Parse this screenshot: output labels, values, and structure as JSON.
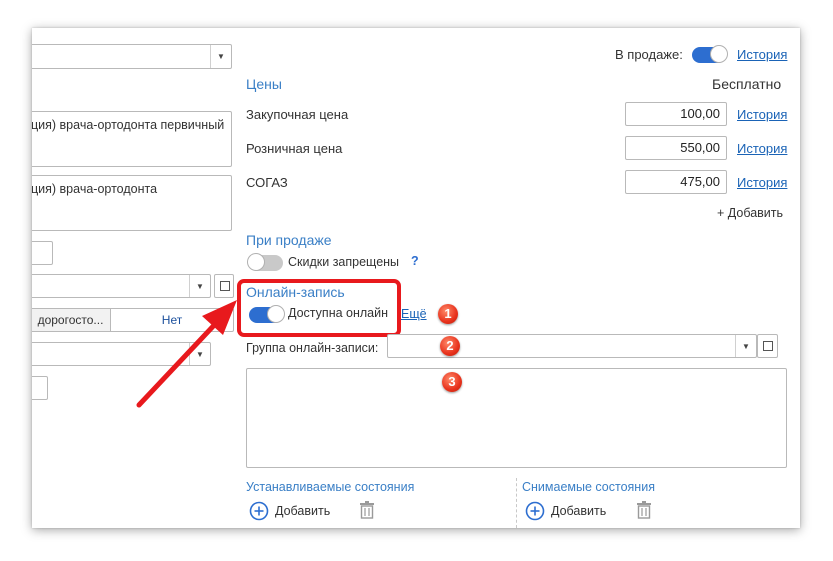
{
  "left": {
    "field1_text": "ция) врача-ортодонта первичный",
    "field2_text": "ция) врача-ортодонта",
    "segmented": {
      "left_label": "дорогосто...",
      "right_label": "Нет"
    }
  },
  "top": {
    "on_sale_label": "В продаже:",
    "history_link": "История"
  },
  "prices": {
    "section_title": "Цены",
    "free_label": "Бесплатно",
    "rows": [
      {
        "label": "Закупочная цена",
        "value": "100,00",
        "history": "История"
      },
      {
        "label": "Розничная цена",
        "value": "550,00",
        "history": "История"
      },
      {
        "label": "СОГАЗ",
        "value": "475,00",
        "history": "История"
      }
    ],
    "add_label": "+ Добавить"
  },
  "on_sale": {
    "section_title": "При продаже",
    "discounts_label": "Скидки запрещены",
    "help": "?"
  },
  "online": {
    "section_title": "Онлайн-запись",
    "available_label": "Доступна онлайн",
    "more_link": "Ещё",
    "group_label": "Группа онлайн-записи:"
  },
  "badges": [
    "1",
    "2",
    "3"
  ],
  "states": {
    "set_title": "Устанавливаемые состояния",
    "removed_title": "Снимаемые состояния",
    "add_label": "Добавить"
  },
  "colors": {
    "accent": "#2d6ed0",
    "link": "#1a63b6",
    "section": "#3a7fc6",
    "highlight": "#e8191d"
  }
}
